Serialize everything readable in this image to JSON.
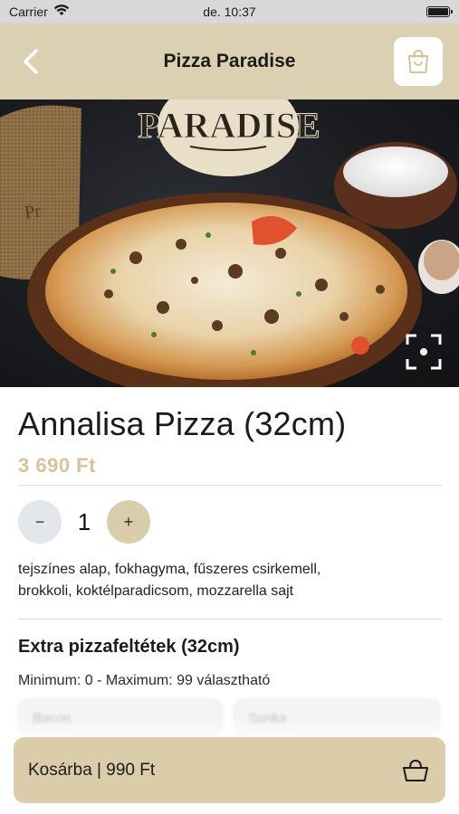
{
  "status_bar": {
    "carrier": "Carrier",
    "time": "de. 10:37",
    "battery_level": 1.0
  },
  "nav": {
    "title": "Pizza Paradise",
    "back_icon": "chevron-left-icon",
    "bag_icon": "shopping-bag-icon"
  },
  "hero": {
    "logo_text": "PARADISE",
    "expand_icon": "scan-expand-icon"
  },
  "product": {
    "name": "Annalisa Pizza (32cm)",
    "price": "3 690 Ft",
    "quantity": "1",
    "minus_label": "−",
    "plus_label": "+",
    "ingredients_line1": "tejszínes alap, fokhagyma, fűszeres csirkemell,",
    "ingredients_line2": "brokkoli, koktélparadicsom, mozzarella sajt"
  },
  "extras": {
    "title": "Extra pizzafeltétek (32cm)",
    "limits": "Minimum: 0 - Maximum: 99 választható",
    "options": [
      "Bacon",
      "Sonka"
    ]
  },
  "cart": {
    "label": "Kosárba | 990 Ft",
    "icon": "basket-icon"
  },
  "colors": {
    "header_bg": "#dcd0b3",
    "accent": "#d5c49a",
    "cart_bg": "#dbcdaa",
    "minus_bg": "#e3e6ea",
    "plus_bg": "#dacdae"
  }
}
